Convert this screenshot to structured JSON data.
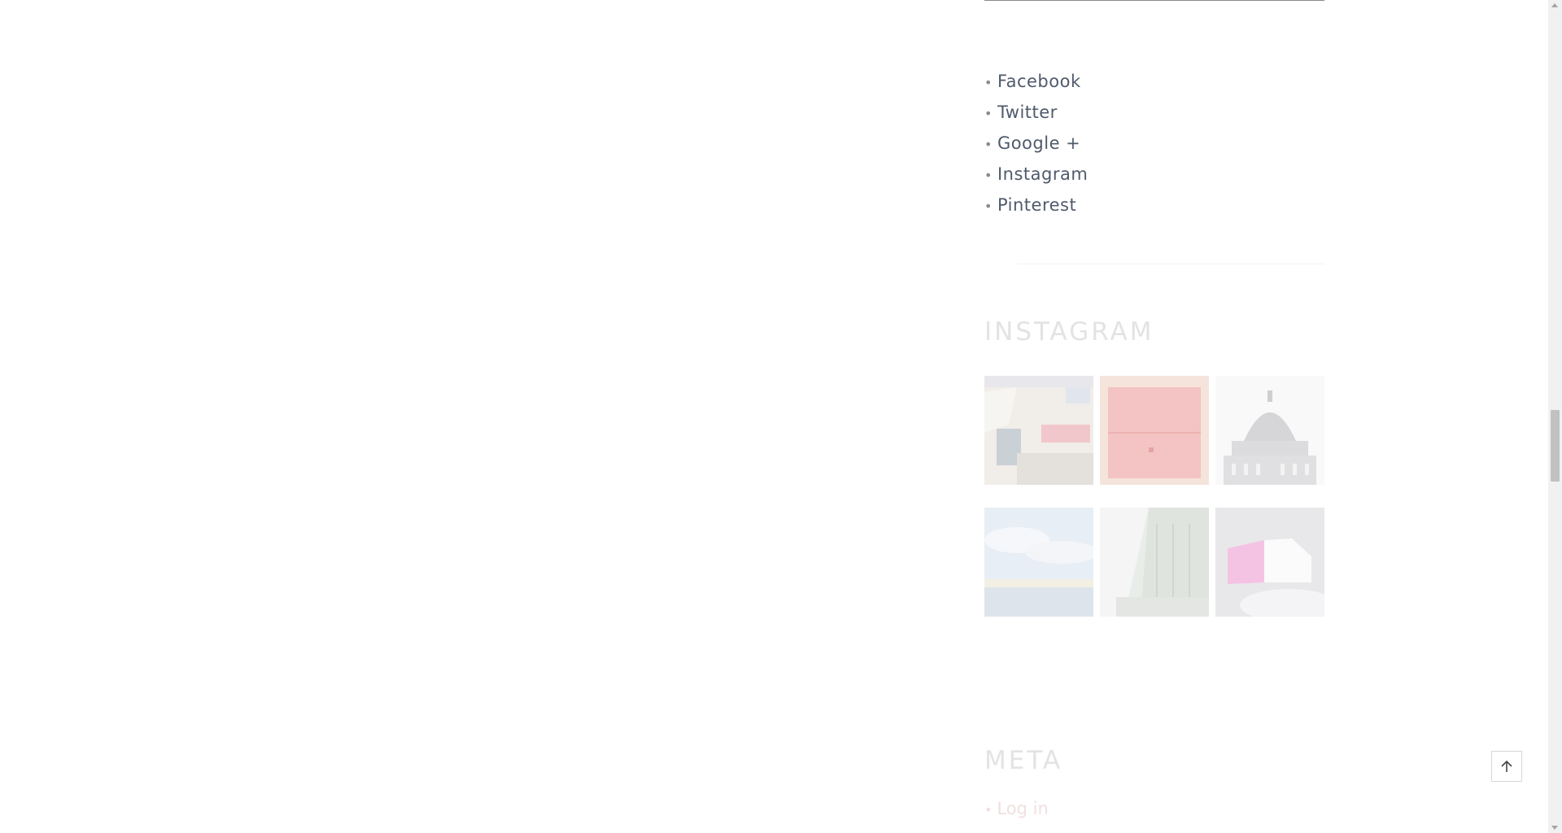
{
  "social": {
    "items": [
      {
        "label": "Facebook"
      },
      {
        "label": "Twitter"
      },
      {
        "label": "Google +"
      },
      {
        "label": "Instagram"
      },
      {
        "label": "Pinterest"
      }
    ],
    "bullet": "•"
  },
  "instagram": {
    "heading": "INSTAGRAM",
    "photos": [
      {
        "icon": "living-room-photo"
      },
      {
        "icon": "red-wall-photo"
      },
      {
        "icon": "dome-building-photo"
      },
      {
        "icon": "sky-sea-photo"
      },
      {
        "icon": "street-building-photo"
      },
      {
        "icon": "pink-box-photo"
      }
    ]
  },
  "meta": {
    "heading": "META",
    "items": [
      {
        "label": "Log in"
      }
    ]
  },
  "back_to_top": {
    "icon": "arrow-up-icon"
  },
  "colors": {
    "link": "#4f5a6b",
    "heading": "#e3e3e3"
  }
}
